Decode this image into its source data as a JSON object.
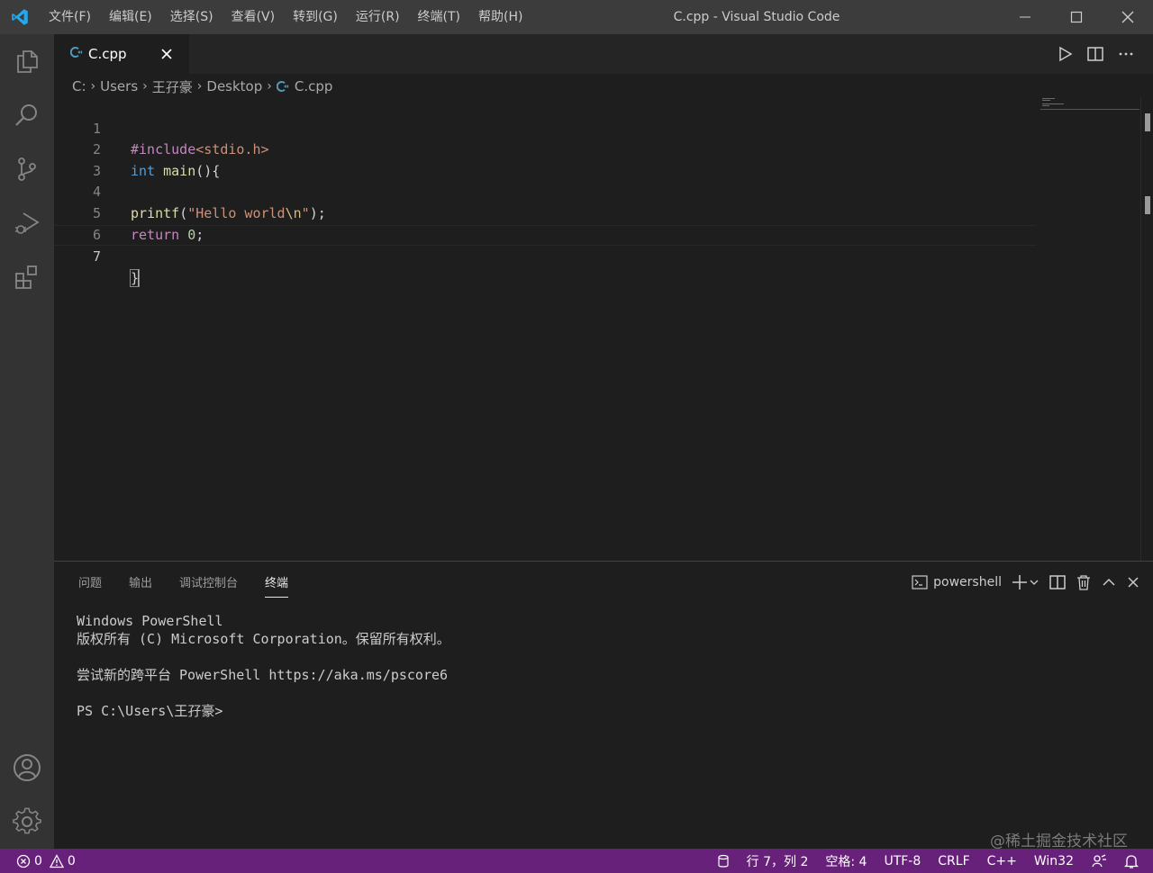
{
  "titlebar": {
    "title": "C.cpp - Visual Studio Code",
    "menu": [
      "文件(F)",
      "编辑(E)",
      "选择(S)",
      "查看(V)",
      "转到(G)",
      "运行(R)",
      "终端(T)",
      "帮助(H)"
    ]
  },
  "tab": {
    "label": "C.cpp"
  },
  "breadcrumb": {
    "drive": "C:",
    "users": "Users",
    "user": "王孖豪",
    "folder": "Desktop",
    "file": "C.cpp"
  },
  "editor": {
    "line_numbers": [
      "1",
      "2",
      "3",
      "4",
      "5",
      "6",
      "7"
    ],
    "lines": {
      "l1_directive": "#include",
      "l1_header": "<stdio.h>",
      "l2_type": "int",
      "l2_fn": "main",
      "l2_rest": "(){",
      "l4_fn": "printf",
      "l4_open": "(",
      "l4_str1": "\"Hello world",
      "l4_esc": "\\n",
      "l4_str2": "\"",
      "l4_close": ");",
      "l5_kw": "return",
      "l5_num": "0",
      "l5_end": ";",
      "l7_brace": "}"
    }
  },
  "panel": {
    "tabs": [
      "问题",
      "输出",
      "调试控制台",
      "终端"
    ],
    "active_tab": "终端",
    "terminal_name": "powershell",
    "terminal_lines": [
      "Windows PowerShell",
      "版权所有 (C) Microsoft Corporation。保留所有权利。",
      "",
      "尝试新的跨平台 PowerShell https://aka.ms/pscore6",
      "",
      "PS C:\\Users\\王孖豪>"
    ]
  },
  "statusbar": {
    "errors": "0",
    "warnings": "0",
    "position": "行 7，列 2",
    "spaces": "空格: 4",
    "encoding": "UTF-8",
    "eol": "CRLF",
    "language": "C++",
    "platform": "Win32"
  },
  "watermark": "@稀土掘金技术社区",
  "colors": {
    "statusbar": "#68217a",
    "titlebar": "#3c3c3c",
    "activitybar": "#333333",
    "editor_bg": "#1e1e1e",
    "accent_blue": "#23a9f2"
  }
}
